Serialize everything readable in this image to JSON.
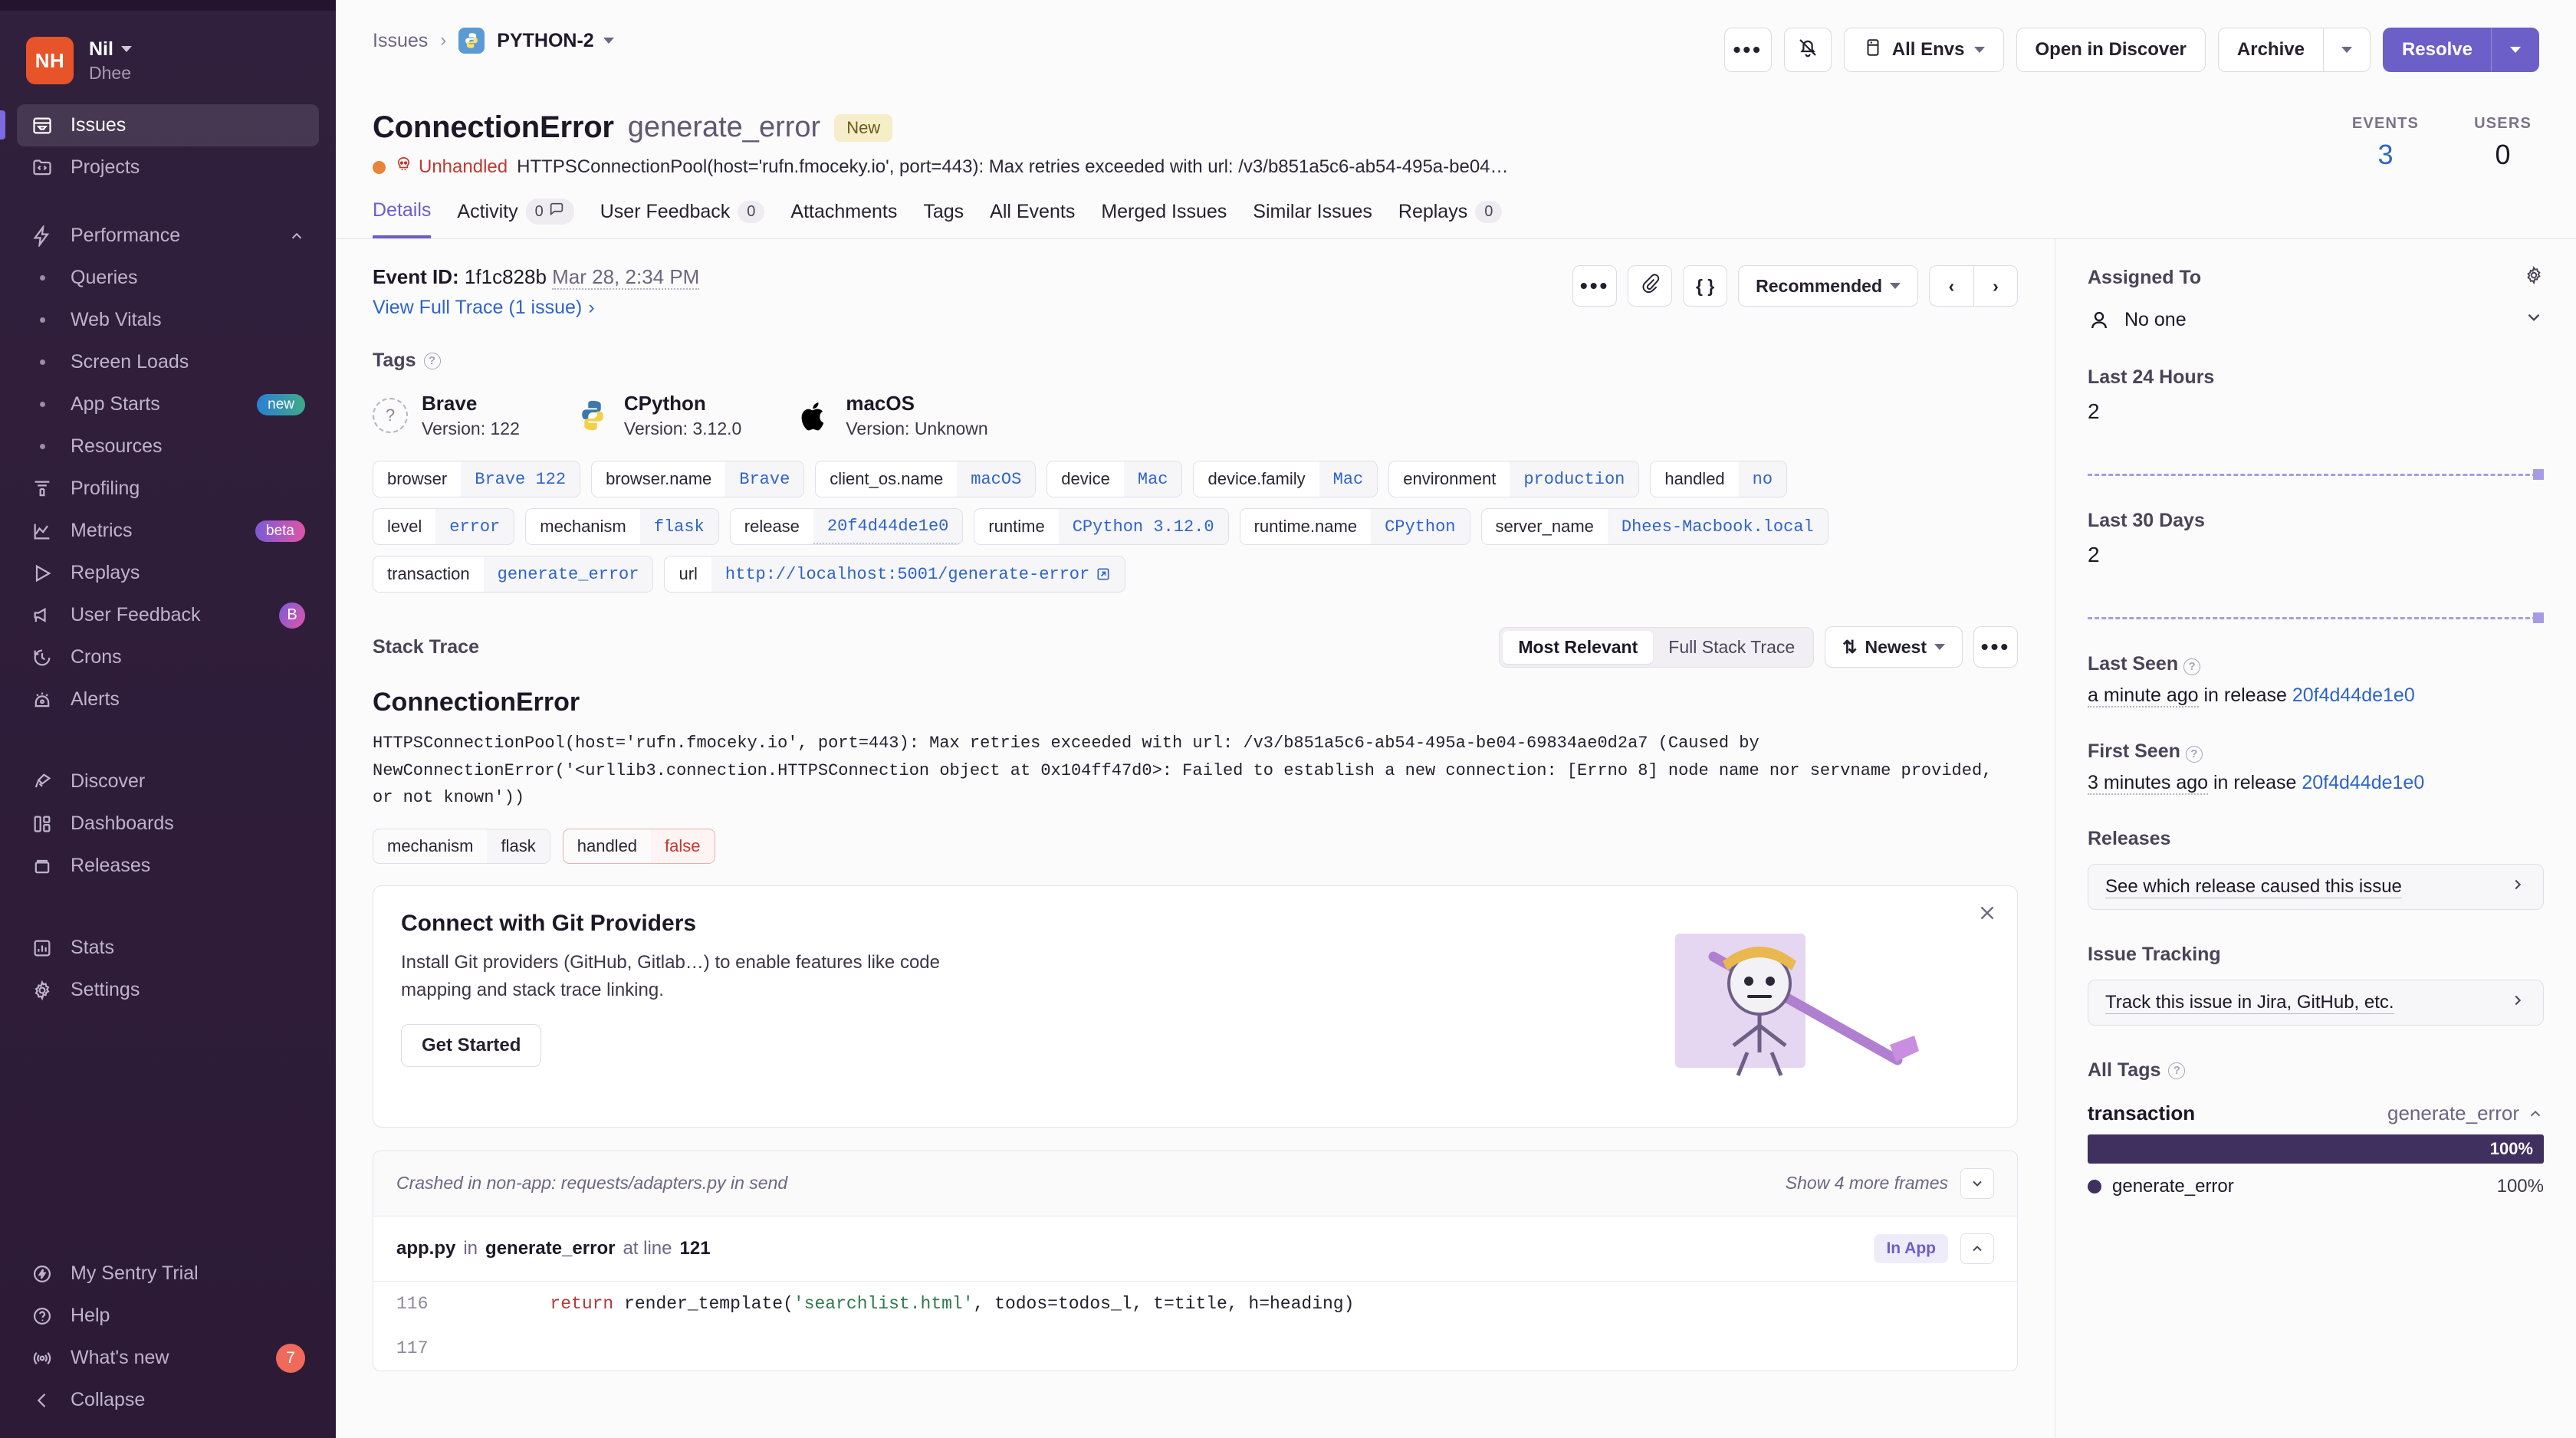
{
  "sidebar": {
    "org": {
      "name": "Nil",
      "sub": "Dhee",
      "avatar_initials": "NH"
    },
    "items": [
      {
        "label": "Issues",
        "icon": "issues-icon",
        "active": true
      },
      {
        "label": "Projects",
        "icon": "projects-icon"
      },
      {
        "label": "Performance",
        "icon": "performance-icon",
        "expandable": true
      },
      {
        "label": "Queries",
        "sub": true
      },
      {
        "label": "Web Vitals",
        "sub": true
      },
      {
        "label": "Screen Loads",
        "sub": true
      },
      {
        "label": "App Starts",
        "sub": true,
        "badge": "new",
        "badge_kind": "new"
      },
      {
        "label": "Resources",
        "sub": true
      },
      {
        "label": "Profiling",
        "icon": "profiling-icon"
      },
      {
        "label": "Metrics",
        "icon": "metrics-icon",
        "badge": "beta",
        "badge_kind": "beta"
      },
      {
        "label": "Replays",
        "icon": "replays-icon"
      },
      {
        "label": "User Feedback",
        "icon": "megaphone-icon",
        "badge": "B",
        "badge_kind": "b"
      },
      {
        "label": "Crons",
        "icon": "crons-icon"
      },
      {
        "label": "Alerts",
        "icon": "alerts-icon"
      },
      {
        "label": "Discover",
        "icon": "discover-icon"
      },
      {
        "label": "Dashboards",
        "icon": "dashboards-icon"
      },
      {
        "label": "Releases",
        "icon": "releases-icon"
      },
      {
        "label": "Stats",
        "icon": "stats-icon"
      },
      {
        "label": "Settings",
        "icon": "gear-icon"
      }
    ],
    "bottom": [
      {
        "label": "My Sentry Trial",
        "icon": "bolt-icon"
      },
      {
        "label": "Help",
        "icon": "help-icon"
      },
      {
        "label": "What's new",
        "icon": "broadcast-icon",
        "badge": "7",
        "badge_kind": "count"
      },
      {
        "label": "Collapse",
        "icon": "chevron-left-icon"
      }
    ]
  },
  "header": {
    "breadcrumb_root": "Issues",
    "breadcrumb_project": "PYTHON-2",
    "actions": {
      "more_label": "•••",
      "mute_label": "",
      "envs_label": "All Envs",
      "discover_label": "Open in Discover",
      "archive_label": "Archive",
      "resolve_label": "Resolve"
    }
  },
  "issue": {
    "error_type": "ConnectionError",
    "culprit": "generate_error",
    "status_chip": "New",
    "level": "Unhandled",
    "message": "HTTPSConnectionPool(host='rufn.fmoceky.io', port=443): Max retries exceeded with url: /v3/b851a5c6-ab54-495a-be04…",
    "events_label": "EVENTS",
    "events_value": "3",
    "users_label": "USERS",
    "users_value": "0"
  },
  "tabs": [
    {
      "label": "Details",
      "active": true
    },
    {
      "label": "Activity",
      "badge": "0",
      "badge_icon": "chat-icon"
    },
    {
      "label": "User Feedback",
      "badge": "0"
    },
    {
      "label": "Attachments"
    },
    {
      "label": "Tags"
    },
    {
      "label": "All Events"
    },
    {
      "label": "Merged Issues"
    },
    {
      "label": "Similar Issues"
    },
    {
      "label": "Replays",
      "badge": "0"
    }
  ],
  "event": {
    "id_label": "Event ID:",
    "id_value": "1f1c828b",
    "date": "Mar 28, 2:34 PM",
    "trace_link": "View Full Trace (1 issue)",
    "sort_label": "Recommended"
  },
  "tags_section": {
    "title": "Tags",
    "cards": [
      {
        "name": "Brave",
        "version_label": "Version: 122",
        "icon": "unknown-browser-icon"
      },
      {
        "name": "CPython",
        "version_label": "Version: 3.12.0",
        "icon": "python-icon"
      },
      {
        "name": "macOS",
        "version_label": "Version: Unknown",
        "icon": "apple-icon"
      }
    ],
    "pills": [
      [
        {
          "k": "browser",
          "v": "Brave 122"
        },
        {
          "k": "browser.name",
          "v": "Brave"
        },
        {
          "k": "client_os.name",
          "v": "macOS"
        },
        {
          "k": "device",
          "v": "Mac"
        },
        {
          "k": "device.family",
          "v": "Mac"
        },
        {
          "k": "environment",
          "v": "production"
        },
        {
          "k": "handled",
          "v": "no"
        }
      ],
      [
        {
          "k": "level",
          "v": "error"
        },
        {
          "k": "mechanism",
          "v": "flask"
        },
        {
          "k": "release",
          "v": "20f4d44de1e0",
          "dotted": true
        },
        {
          "k": "runtime",
          "v": "CPython 3.12.0"
        },
        {
          "k": "runtime.name",
          "v": "CPython"
        },
        {
          "k": "server_name",
          "v": "Dhees-Macbook.local"
        }
      ],
      [
        {
          "k": "transaction",
          "v": "generate_error"
        },
        {
          "k": "url",
          "v": "http://localhost:5001/generate-error",
          "external": true
        }
      ]
    ]
  },
  "stack_trace": {
    "title": "Stack Trace",
    "seg_most_relevant": "Most Relevant",
    "seg_full": "Full Stack Trace",
    "sort_label": "Newest",
    "error_name": "ConnectionError",
    "error_body": "HTTPSConnectionPool(host='rufn.fmoceky.io', port=443): Max retries exceeded with url: /v3/b851a5c6-ab54-495a-be04-69834ae0d2a7 (Caused by NewConnectionError('<urllib3.connection.HTTPSConnection object at 0x104ff47d0>: Failed to establish a new connection: [Errno 8] node name nor servname provided, or not known'))",
    "mini_pills": [
      {
        "k": "mechanism",
        "v": "flask",
        "danger": false
      },
      {
        "k": "handled",
        "v": "false",
        "danger": true
      }
    ]
  },
  "promo": {
    "heading": "Connect with Git Providers",
    "paragraph": "Install Git providers (GitHub, Gitlab…) to enable features like code mapping and stack trace linking.",
    "button": "Get Started"
  },
  "frames": {
    "crashed_note": "Crashed in non-app: requests/adapters.py in send",
    "show_more": "Show 4 more frames",
    "file": "app.py",
    "in_word": "in",
    "function": "generate_error",
    "at_line_label": "at line",
    "line_number": "121",
    "in_app_badge": "In App",
    "code": [
      {
        "ln": "116",
        "indent": "        ",
        "kw": "return",
        "rest_a": " render_template(",
        "str": "'searchlist.html'",
        "rest_b": ", todos=todos_l, t=title, h=heading)"
      },
      {
        "ln": "117",
        "indent": "",
        "kw": "",
        "rest_a": "",
        "str": "",
        "rest_b": ""
      }
    ]
  },
  "right": {
    "assigned_title": "Assigned To",
    "assignee": "No one",
    "last24_title": "Last 24 Hours",
    "last24_value": "2",
    "last30_title": "Last 30 Days",
    "last30_value": "2",
    "last_seen_title": "Last Seen",
    "last_seen_time": "a minute ago",
    "last_seen_mid": " in release ",
    "last_seen_release": "20f4d44de1e0",
    "first_seen_title": "First Seen",
    "first_seen_time": "3 minutes ago",
    "first_seen_mid": " in release ",
    "first_seen_release": "20f4d44de1e0",
    "releases_title": "Releases",
    "releases_btn": "See which release caused this issue",
    "tracking_title": "Issue Tracking",
    "tracking_btn": "Track this issue in Jira, GitHub, etc.",
    "all_tags_title": "All Tags",
    "tag_key": "transaction",
    "tag_value": "generate_error",
    "tag_pct": "100%",
    "tag_item": "generate_error",
    "tag_item_pct": "100%"
  },
  "colors": {
    "accent": "#6c5fc7",
    "sidebar_bg": "#2f1d3b",
    "link": "#2f64c8",
    "danger": "#c2382f",
    "orange": "#e8833a"
  }
}
